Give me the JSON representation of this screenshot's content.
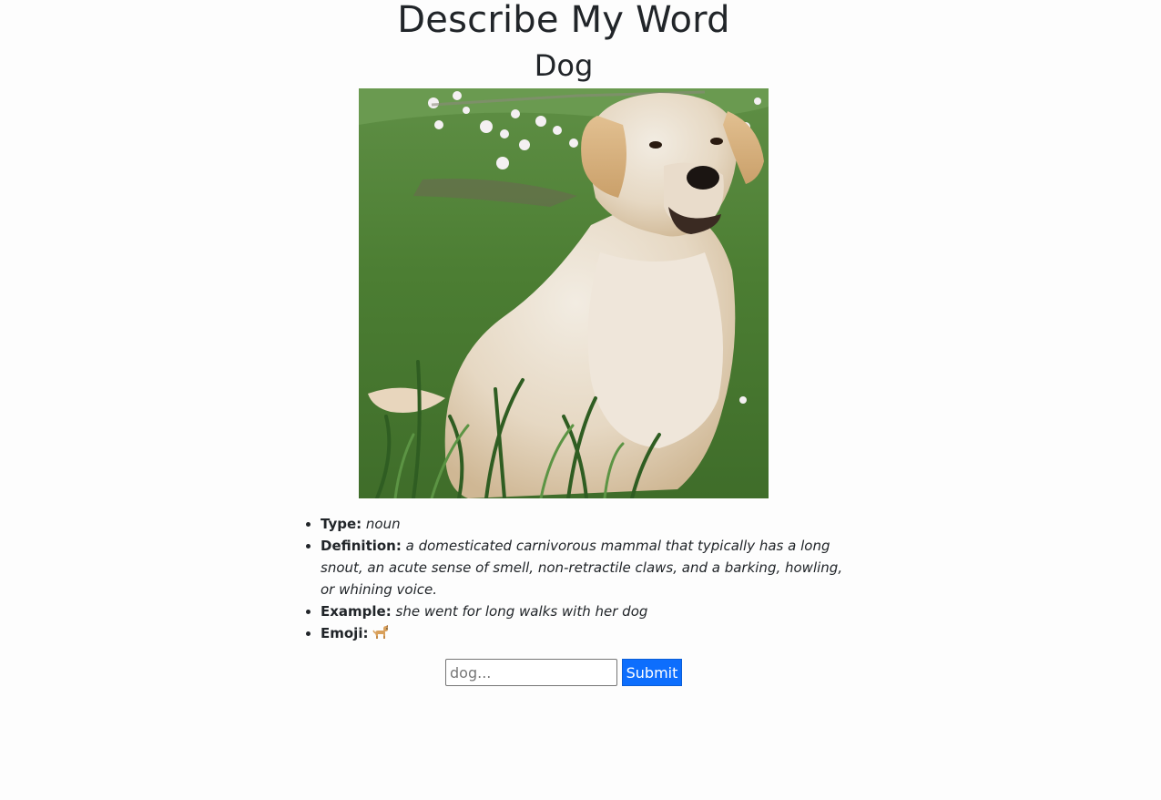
{
  "header": {
    "title": "Describe My Word"
  },
  "word": {
    "name": "Dog",
    "image_icon": "dog-photo"
  },
  "details": {
    "type_label": "Type:",
    "type_value": "noun",
    "definition_label": "Definition:",
    "definition_value": "a domesticated carnivorous mammal that typically has a long snout, an acute sense of smell, non-retractile claws, and a barking, howling, or whining voice.",
    "example_label": "Example:",
    "example_value": "she went for long walks with her dog",
    "emoji_label": "Emoji:",
    "emoji_icon": "dog-emoji"
  },
  "form": {
    "input_value": "",
    "input_placeholder": "dog...",
    "submit_label": "Submit"
  },
  "colors": {
    "accent": "#0d6efd",
    "text": "#212529",
    "background": "#fdfdfd"
  }
}
